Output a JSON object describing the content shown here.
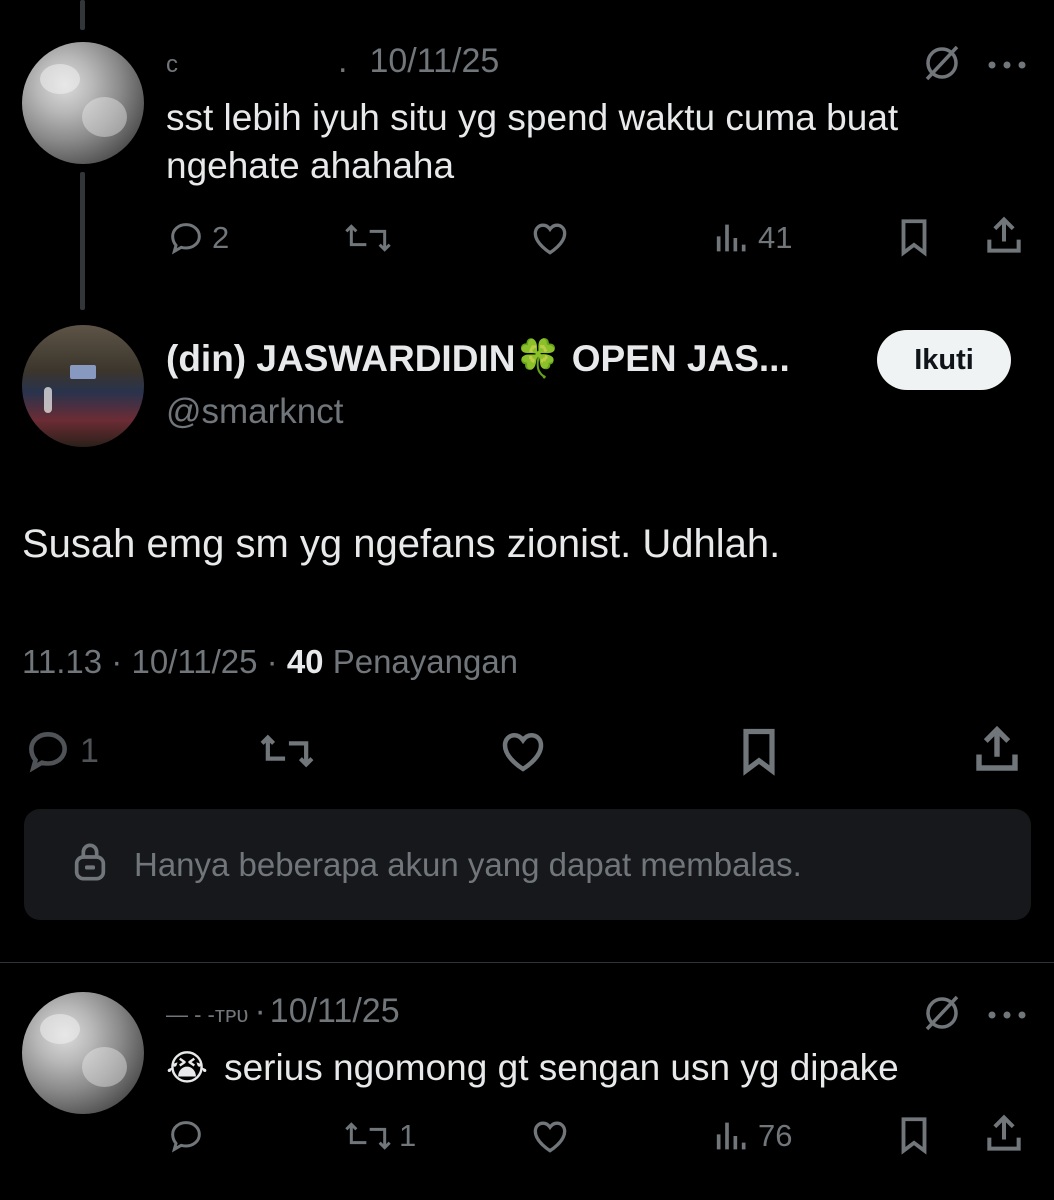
{
  "replies": [
    {
      "name_fragment": "ᴄ",
      "sep": ".",
      "date": "10/11/25",
      "text_line1": "sst lebih iyuh situ yg spend waktu cuma buat",
      "text_line2": "ngehate ahahaha",
      "reply_count": "2",
      "retweet_count": "",
      "views": "41"
    },
    {
      "name_fragment": "—  ‐  ‐ᴛᴘᴜ",
      "sep": "·",
      "date": "10/11/25",
      "emoji": "😭",
      "text": "serius ngomong gt sengan usn yg dipake",
      "reply_count": "",
      "retweet_count": "1",
      "views": "76"
    }
  ],
  "main_post": {
    "display_name": "(din) JASWARDIDIN🍀 OPEN JAS...",
    "handle": "@smarknct",
    "follow_label": "Ikuti",
    "text": "Susah emg sm yg ngefans zionist. Udhlah.",
    "time": "11.13",
    "date": "10/11/25",
    "views_count": "40",
    "views_label": "Penayangan",
    "reply_count": "1",
    "restricted_text": "Hanya beberapa akun yang dapat membalas."
  },
  "icons": {
    "grok": "grok-icon",
    "more": "more-icon",
    "reply": "reply-icon",
    "retweet": "retweet-icon",
    "like": "like-icon",
    "views": "views-icon",
    "bookmark": "bookmark-icon",
    "share": "share-icon",
    "lock": "lock-icon"
  }
}
